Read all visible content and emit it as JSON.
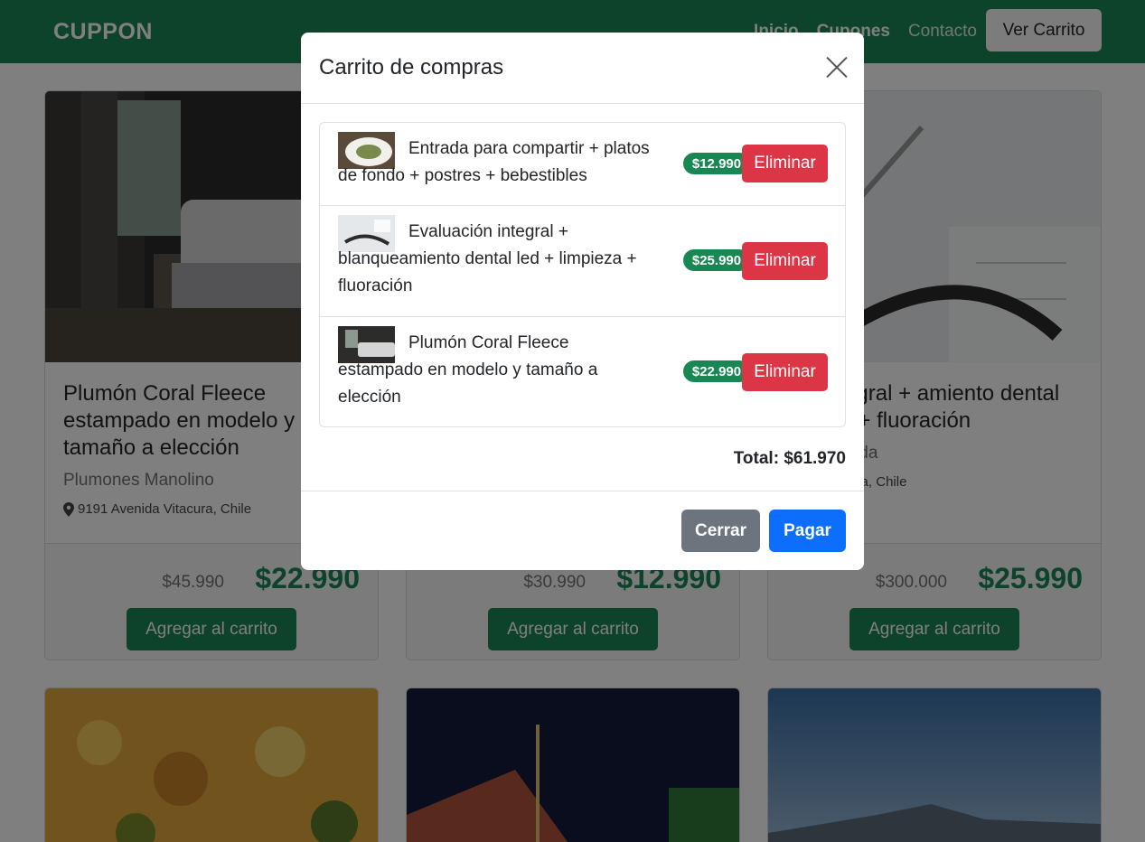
{
  "navbar": {
    "brand": "CUPPON",
    "links": [
      "Inicio",
      "Cupones",
      "Contacto"
    ],
    "cart_button": "Ver Carrito"
  },
  "cards": [
    {
      "title": "Plumón Coral Fleece estampado en modelo y tamaño a elección",
      "vendor": "Plumones Manolino",
      "address": "9191 Avenida Vitacura, Chile",
      "old_price": "$45.990",
      "new_price": "$22.990",
      "button": "Agregar al carrito"
    },
    {
      "title": "",
      "vendor": "",
      "address": "",
      "old_price": "$30.990",
      "new_price": "$12.990",
      "button": "Agregar al carrito"
    },
    {
      "title": "ión integral + amiento dental led + a + fluoración",
      "vendor": "ntal Quijada",
      "address": "nco Encalada, Chile",
      "old_price": "$300.000",
      "new_price": "$25.990",
      "button": "Agregar al carrito"
    }
  ],
  "modal": {
    "title": "Carrito de compras",
    "items": [
      {
        "line1": "Entrada para compartir + platos",
        "rest": [
          "de fondo + postres + bebestibles"
        ],
        "price": "$12.990",
        "remove": "Eliminar"
      },
      {
        "line1": "Evaluación integral +",
        "rest": [
          "blanqueamiento dental led + limpieza +",
          "fluoración"
        ],
        "price": "$25.990",
        "remove": "Eliminar"
      },
      {
        "line1": "Plumón Coral Fleece",
        "rest": [
          "estampado en modelo y tamaño a",
          "elección"
        ],
        "price": "$22.990",
        "remove": "Eliminar"
      }
    ],
    "total": "Total: $61.970",
    "close_button": "Cerrar",
    "pay_button": "Pagar"
  },
  "colors": {
    "brand_green": "#198754",
    "danger": "#dc3545",
    "primary": "#0d6efd",
    "secondary": "#6c757d"
  }
}
